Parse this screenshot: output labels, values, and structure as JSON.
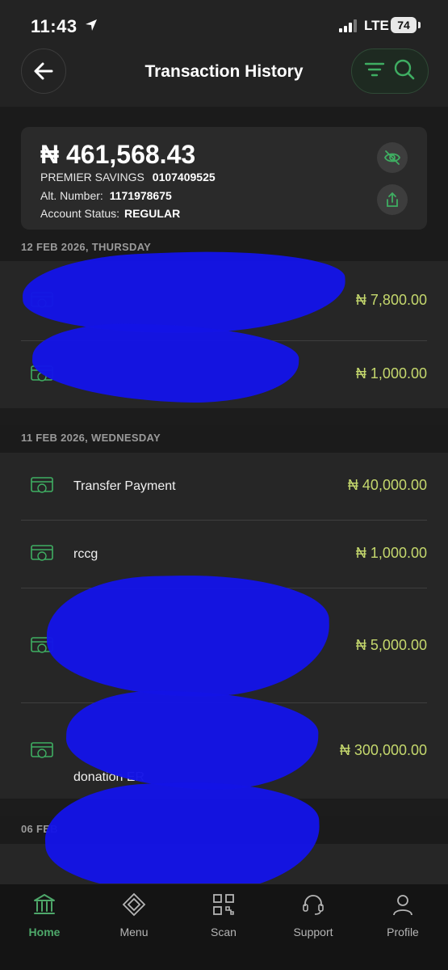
{
  "status_bar": {
    "time": "11:43",
    "network": "LTE",
    "battery": "74"
  },
  "header": {
    "title": "Transaction History"
  },
  "account": {
    "balance": "₦ 461,568.43",
    "type_label": "PREMIER SAVINGS",
    "account_number": "0107409525",
    "alt_label": "Alt. Number:",
    "alt_number": "1171978675",
    "status_label": "Account Status:",
    "status_value": "REGULAR"
  },
  "groups": [
    {
      "date": "12 FEB 2026, THURSDAY",
      "transactions": [
        {
          "desc": "",
          "amount": "₦ 7,800.00"
        },
        {
          "desc": "",
          "amount": "₦ 1,000.00"
        }
      ]
    },
    {
      "date": "11 FEB 2026, WEDNESDAY",
      "transactions": [
        {
          "desc": "Transfer Payment",
          "amount": "₦ 40,000.00"
        },
        {
          "desc": "rccg",
          "amount": "₦ 1,000.00"
        },
        {
          "desc": "",
          "amount": "₦ 5,000.00"
        },
        {
          "desc": "donation ER",
          "amount": "₦ 300,000.00"
        }
      ]
    },
    {
      "date": "06 FEB",
      "transactions": []
    }
  ],
  "nav": [
    {
      "label": "Home",
      "icon": "bank-icon",
      "active": true
    },
    {
      "label": "Menu",
      "icon": "diamond-icon",
      "active": false
    },
    {
      "label": "Scan",
      "icon": "qr-code-icon",
      "active": false
    },
    {
      "label": "Support",
      "icon": "headset-icon",
      "active": false
    },
    {
      "label": "Profile",
      "icon": "person-icon",
      "active": false
    }
  ],
  "colors": {
    "accent": "#4ea86a",
    "amount": "#c5d86d",
    "redaction": "#1414e6"
  }
}
